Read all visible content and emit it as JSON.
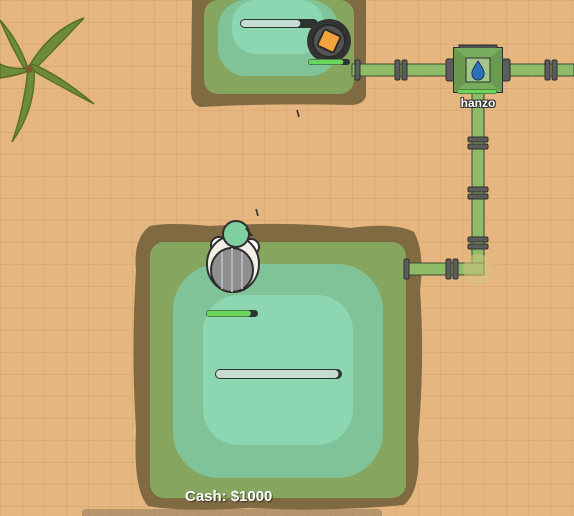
{
  "hud": {
    "cash_label": "Cash:",
    "cash_value": "$1000"
  },
  "players": [
    {
      "name": "hanzo"
    }
  ],
  "bars": {
    "top_pond_progress": 0.78,
    "turret_health": 0.85,
    "player_health": 0.87,
    "main_pond_progress": 0.98,
    "hanzo_health": 1.0
  },
  "icons": {
    "player": "armored-player-icon",
    "turret": "turret-icon",
    "hub": "water-hub-icon",
    "tree": "palm-tree-icon"
  },
  "colors": {
    "sand": "#e5b67f",
    "mud": "#7f6a41",
    "grass": "#86a660",
    "water": "#87d2ae",
    "pipe": "#8dbb68",
    "health": "#6bd65c"
  }
}
